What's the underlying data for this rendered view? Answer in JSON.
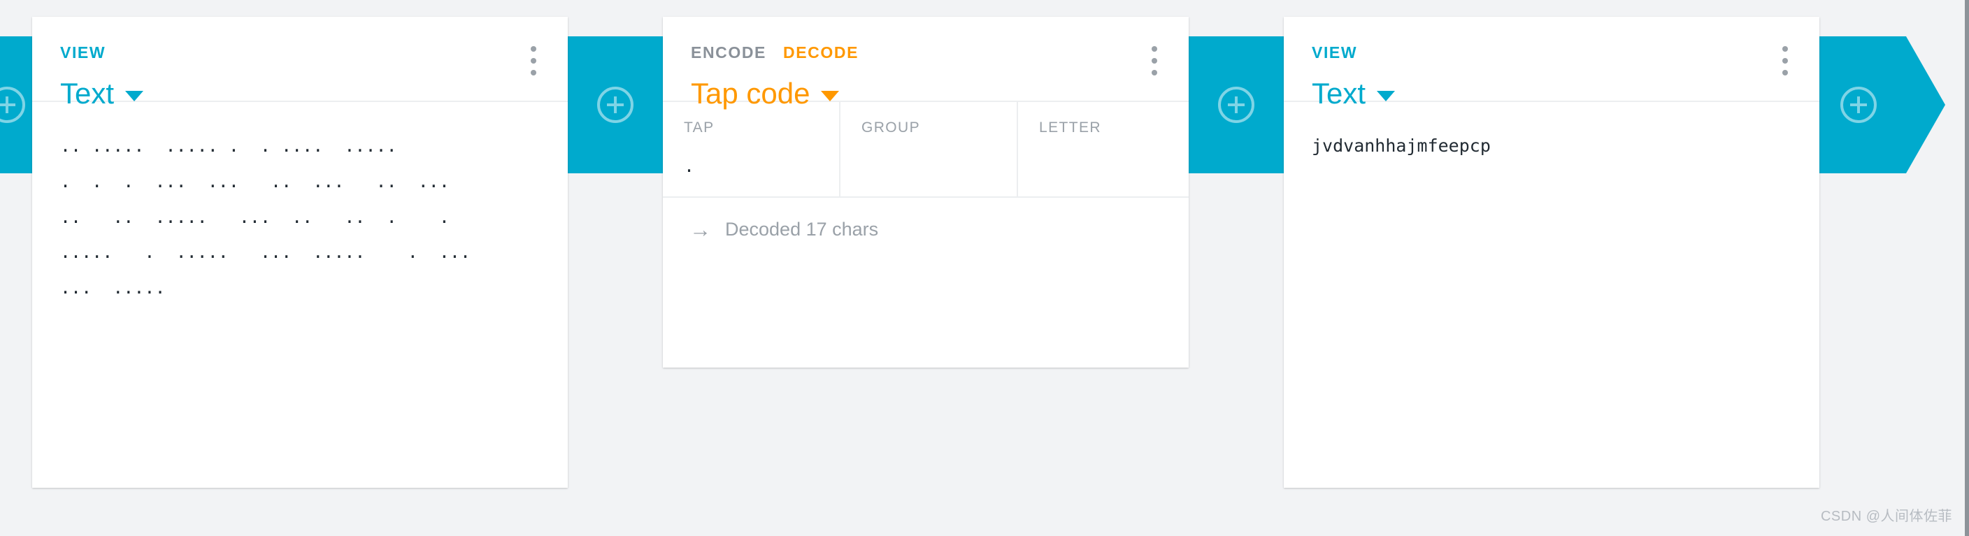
{
  "theme": {
    "accent_cyan": "#00aacd",
    "accent_orange": "#ff9800",
    "muted_gray": "#9aa1a8",
    "page_background": "#f2f3f5",
    "card_background": "#ffffff"
  },
  "pipeline": {
    "connectors": [
      {
        "name": "add-brick-left",
        "icon": "plus-circle-icon"
      },
      {
        "name": "add-brick-middle",
        "icon": "plus-circle-icon"
      },
      {
        "name": "add-brick-right",
        "icon": "plus-circle-icon"
      },
      {
        "name": "add-brick-end",
        "icon": "plus-circle-icon"
      }
    ]
  },
  "cards": [
    {
      "id": "source-view",
      "kicker": "VIEW",
      "title": "Text",
      "caret_icon": "chevron-down-icon",
      "menu_icon": "kebab-menu-icon",
      "content": ".. .....  ..... .  . ....  .....\n.  .  .  ...  ...   ..  ...   ..  ...\n..   ..  .....   ...  ..   ..  .    .\n.....   .  .....   ...  .....    .  ...\n...  ....."
    },
    {
      "id": "tap-code-brick",
      "tabs": [
        {
          "label": "ENCODE",
          "active": false
        },
        {
          "label": "DECODE",
          "active": true
        }
      ],
      "title": "Tap code",
      "caret_icon": "chevron-down-icon",
      "menu_icon": "kebab-menu-icon",
      "table": {
        "columns": [
          "TAP",
          "GROUP",
          "LETTER"
        ],
        "rows": [
          {
            "tap": ".",
            "group": "",
            "letter": ""
          }
        ]
      },
      "status": {
        "icon": "right-arrow-icon",
        "text": "Decoded 17 chars"
      }
    },
    {
      "id": "result-view",
      "kicker": "VIEW",
      "title": "Text",
      "caret_icon": "chevron-down-icon",
      "menu_icon": "kebab-menu-icon",
      "content": "jvdvanhhajmfeepcp"
    }
  ],
  "watermark": "CSDN @人间体佐菲"
}
